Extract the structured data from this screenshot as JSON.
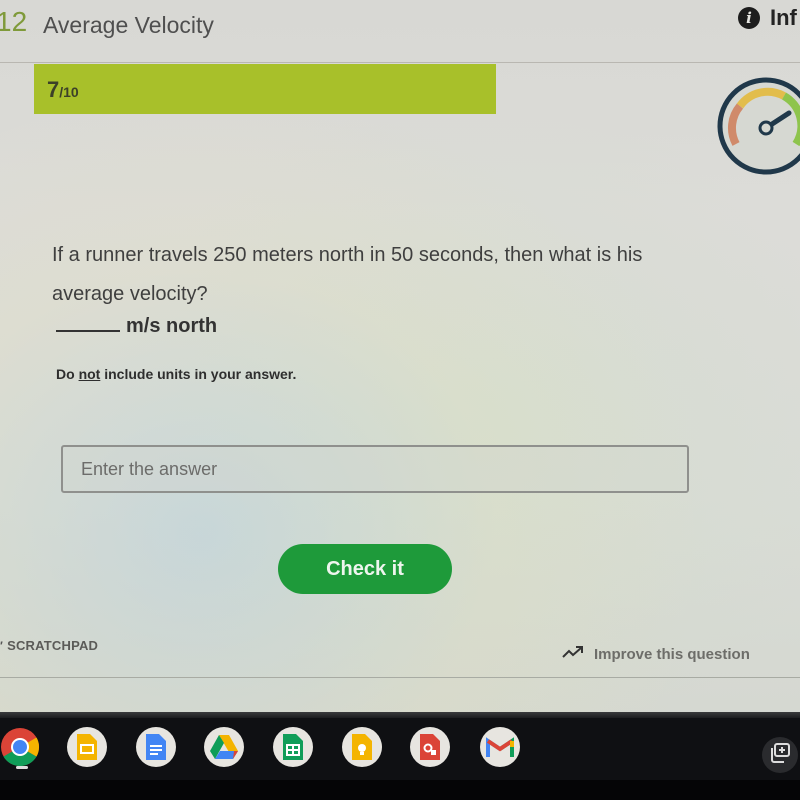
{
  "header": {
    "lesson_number": "12",
    "lesson_title": "Average Velocity",
    "info_label": "Inf",
    "info_icon": "info-circle-icon"
  },
  "progress": {
    "current": "7",
    "total": "/10",
    "fraction": 0.7,
    "color": "#a8c02a"
  },
  "gauge": {
    "icon": "speedometer-gauge-icon",
    "level": 0.85
  },
  "question": {
    "text": "If a runner travels 250 meters north in 50 seconds, then what is his average velocity?",
    "answer_units": "m/s north",
    "hint_prefix": "Do ",
    "hint_emphasis": "not",
    "hint_suffix": " include units in your answer."
  },
  "answer_input": {
    "value": "",
    "placeholder": "Enter the answer"
  },
  "actions": {
    "check_label": "Check it",
    "check_color": "#1e9a3a"
  },
  "footer": {
    "scratchpad_label": "SCRATCHPAD",
    "improve_label": "Improve this question"
  },
  "shelf": {
    "apps": [
      {
        "name": "Chrome",
        "icon": "chrome-icon"
      },
      {
        "name": "Google Slides",
        "icon": "slides-icon"
      },
      {
        "name": "Google Docs",
        "icon": "docs-icon"
      },
      {
        "name": "Google Drive",
        "icon": "drive-icon"
      },
      {
        "name": "Google Sheets",
        "icon": "sheets-icon"
      },
      {
        "name": "Google Keep",
        "icon": "keep-icon"
      },
      {
        "name": "Google Drawings",
        "icon": "drawings-icon"
      },
      {
        "name": "Gmail",
        "icon": "gmail-icon"
      }
    ],
    "overview_icon": "overview-icon"
  }
}
